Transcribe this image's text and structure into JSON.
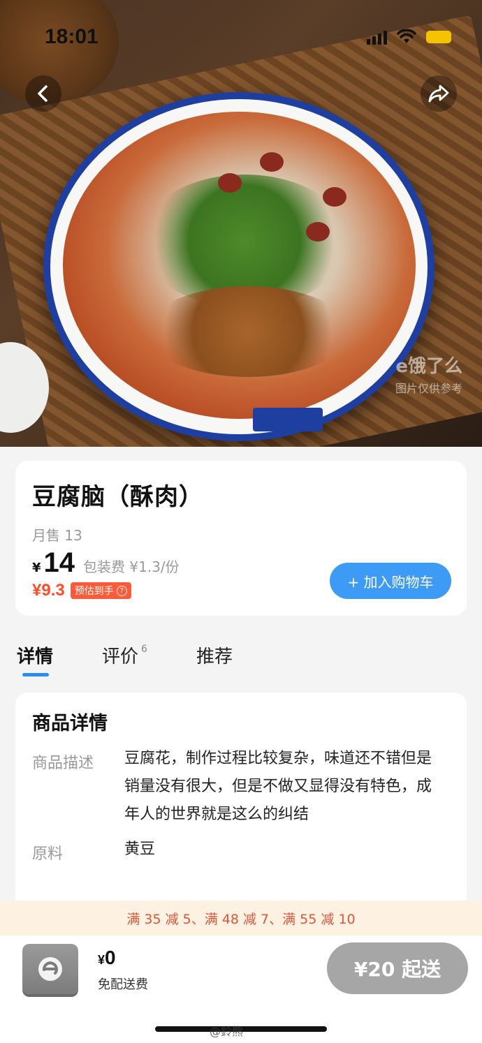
{
  "status_bar": {
    "time": "18:01"
  },
  "hero": {
    "watermark_logo": "e饿了么",
    "watermark_note": "图片仅供参考"
  },
  "product": {
    "title": "豆腐脑（酥肉）",
    "monthly_sales": "月售 13",
    "currency_symbol": "¥",
    "price": "14",
    "packaging_fee": "包装费 ¥1.3/份",
    "estimated_price": "¥9.3",
    "estimated_label": "预估到手",
    "add_to_cart_label": "+ 加入购物车"
  },
  "tabs": [
    {
      "label": "详情",
      "badge": ""
    },
    {
      "label": "评价",
      "badge": "6"
    },
    {
      "label": "推荐",
      "badge": ""
    }
  ],
  "detail": {
    "section_title": "商品详情",
    "description_key": "商品描述",
    "description_value": "豆腐花，制作过程比较复杂，味道还不错但是销量没有很大，但是不做又显得没有特色，成年人的世界就是这么的纠结",
    "ingredients_key": "原料",
    "ingredients_value": "黄豆"
  },
  "promo": {
    "text": "满 35 减 5、满 48 减 7、满 55 减 10"
  },
  "bottom_bar": {
    "currency_symbol": "¥",
    "cart_total": "0",
    "delivery_fee": "免配送费",
    "min_order_label": "¥20 起送"
  },
  "watermark_credit": "@鈴熊",
  "colors": {
    "accent_blue": "#3d9bf5",
    "price_red": "#ff4b2b",
    "promo_bg": "#fdf2e2",
    "disabled_gray": "#a6a6a6"
  }
}
